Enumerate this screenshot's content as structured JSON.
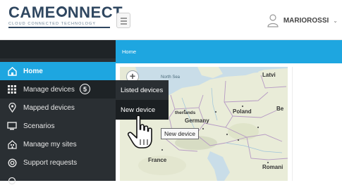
{
  "header": {
    "logo_text_left": "CAME",
    "logo_text_right": "NNECT",
    "logo_tagline": "CLOUD CONNECTED TECHNOLOGY",
    "menu_icon": "hamburger-icon",
    "user_icon": "user-icon",
    "username": "MARIOROSSI",
    "user_caret": "⌄"
  },
  "breadcrumb": {
    "label": "Home"
  },
  "sidebar": {
    "items": [
      {
        "label": "Home",
        "icon": "home-icon",
        "active": true
      },
      {
        "label": "Manage devices",
        "icon": "grid-icon",
        "active": false
      },
      {
        "label": "Mapped devices",
        "icon": "map-pin-icon",
        "active": false
      },
      {
        "label": "Scenarios",
        "icon": "monitor-icon",
        "active": false
      },
      {
        "label": "Manage my sites",
        "icon": "building-icon",
        "active": false
      },
      {
        "label": "Support requests",
        "icon": "support-icon",
        "active": false
      }
    ],
    "step_badge": "5"
  },
  "submenu": {
    "items": [
      {
        "label": "Listed devices"
      },
      {
        "label": "New device"
      }
    ]
  },
  "tooltip": {
    "text": "New device"
  },
  "map": {
    "zoom_in_label": "+",
    "labels": {
      "latvia": "Latvi",
      "north_sea": "North Sea",
      "poland": "Poland",
      "netherlands": "therlands",
      "germany": "Germany",
      "belarus": "Be",
      "france": "France",
      "romania": "Romani"
    }
  },
  "colors": {
    "accent": "#1ea6e0",
    "sidebar_bg": "#2a2f33",
    "submenu_hover": "#1b1f22",
    "logo": "#2f4760"
  }
}
